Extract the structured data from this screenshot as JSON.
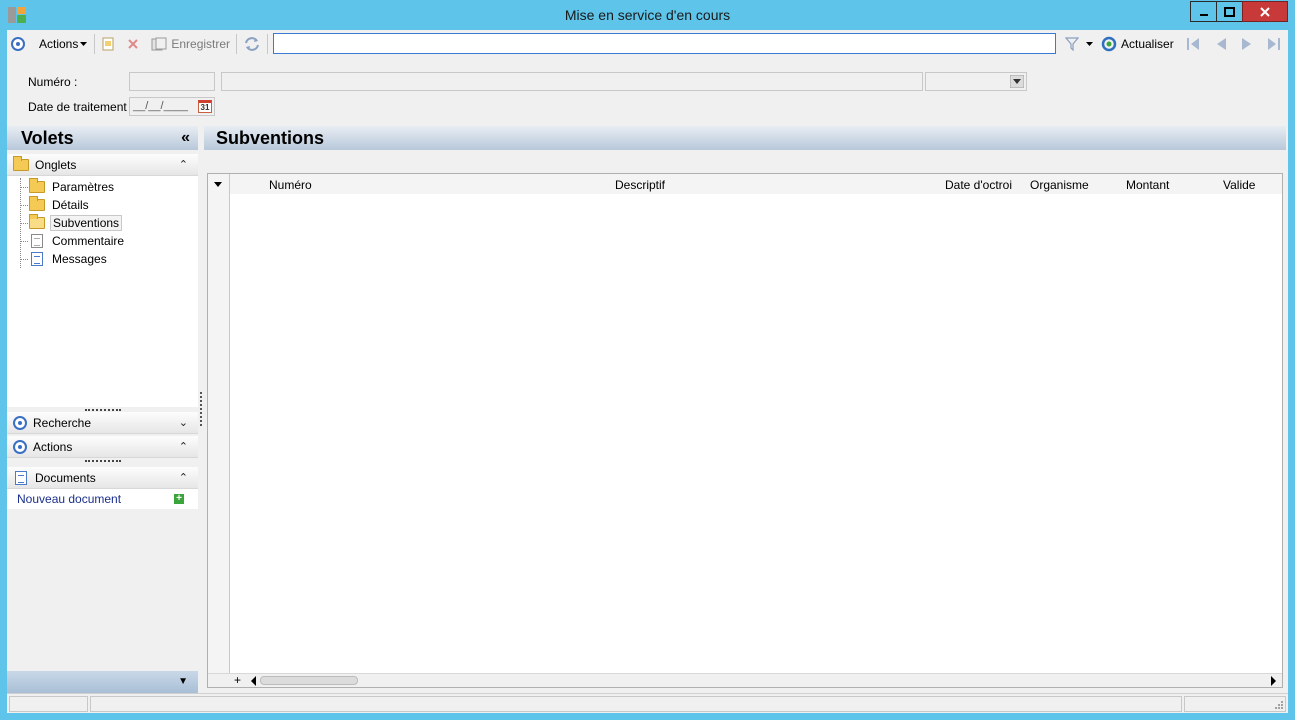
{
  "window": {
    "title": "Mise en service d'en cours",
    "controls": [
      "minimize-icon",
      "maximize-icon",
      "close-icon"
    ]
  },
  "toolbar": {
    "actions_label": "Actions",
    "save_label": "Enregistrer",
    "search_value": "",
    "refresh_label": "Actualiser"
  },
  "fields": {
    "numero_label": "Numéro :",
    "date_label": "Date de traitement :",
    "date_value": "__/__/____",
    "calendar_day": "31"
  },
  "volets": {
    "title": "Volets",
    "collapse_glyph": "«",
    "onglets": {
      "label": "Onglets",
      "items": [
        {
          "label": "Paramètres",
          "icon": "folder-icon"
        },
        {
          "label": "Détails",
          "icon": "folder-icon"
        },
        {
          "label": "Subventions",
          "icon": "folder-open-icon",
          "selected": true
        },
        {
          "label": "Commentaire",
          "icon": "document-icon"
        },
        {
          "label": "Messages",
          "icon": "document-blue-icon"
        }
      ]
    },
    "recherche_label": "Recherche",
    "actions_label": "Actions",
    "documents": {
      "label": "Documents",
      "new_label": "Nouveau document"
    }
  },
  "main": {
    "title": "Subventions",
    "columns": [
      "Numéro",
      "Descriptif",
      "Date d'octroi",
      "Organisme",
      "Montant",
      "Valide"
    ]
  },
  "colors": {
    "frame": "#5ec4ea",
    "header_gradient_top": "#e8edf3",
    "header_gradient_bottom": "#b8c8da",
    "link": "#1a2f8c",
    "close_button": "#c83a3a"
  }
}
